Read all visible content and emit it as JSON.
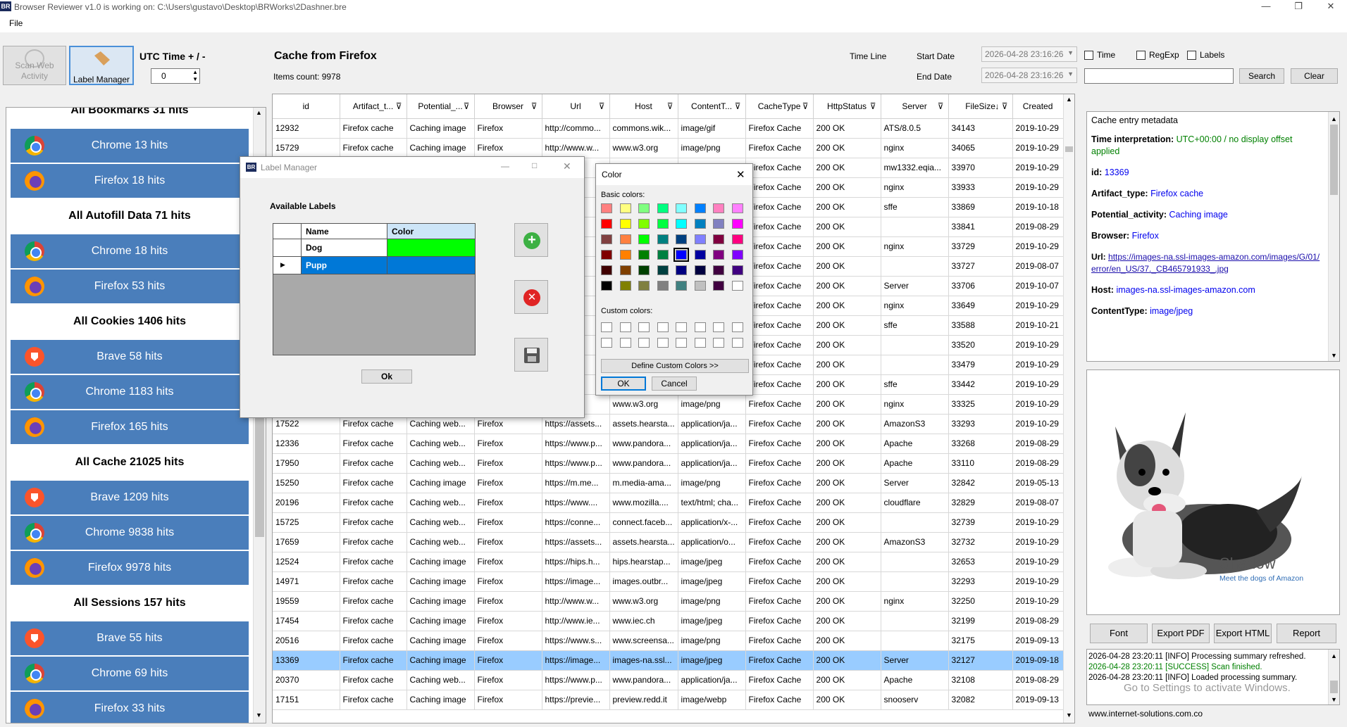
{
  "window": {
    "logo": "BR",
    "title": "Browser Reviewer v1.0 is working on:  C:\\Users\\gustavo\\Desktop\\BRWorks\\2Dashner.bre"
  },
  "menu": {
    "file": "File"
  },
  "toolbar": {
    "scan_label": "Scan Web Activity",
    "label_manager": "Label Manager",
    "utc_label": "UTC Time + / -",
    "utc_value": "0"
  },
  "cache": {
    "title": "Cache from Firefox",
    "count": "Items count: 9978"
  },
  "filters": {
    "timeline": "Time Line",
    "start_label": "Start Date",
    "end_label": "End Date",
    "start_value": "2026-04-28 23:16:26",
    "end_value": "2026-04-28 23:16:26",
    "time": "Time",
    "regexp": "RegExp",
    "labels": "Labels",
    "search": "Search",
    "clear": "Clear"
  },
  "left": {
    "rows": [
      {
        "type": "hdr",
        "text": "All Bookmarks 31 hits"
      },
      {
        "type": "item",
        "icon": "chrome",
        "text": "Chrome 13 hits"
      },
      {
        "type": "item",
        "icon": "firefox",
        "text": "Firefox 18 hits"
      },
      {
        "type": "hdr",
        "text": "All Autofill Data 71 hits"
      },
      {
        "type": "item",
        "icon": "chrome",
        "text": "Chrome 18 hits"
      },
      {
        "type": "item",
        "icon": "firefox",
        "text": "Firefox 53 hits"
      },
      {
        "type": "hdr",
        "text": "All Cookies 1406 hits"
      },
      {
        "type": "item",
        "icon": "brave",
        "text": "Brave 58 hits"
      },
      {
        "type": "item",
        "icon": "chrome",
        "text": "Chrome 1183 hits"
      },
      {
        "type": "item",
        "icon": "firefox",
        "text": "Firefox 165 hits"
      },
      {
        "type": "hdr",
        "text": "All Cache 21025 hits"
      },
      {
        "type": "item",
        "icon": "brave",
        "text": "Brave 1209 hits"
      },
      {
        "type": "item",
        "icon": "chrome",
        "text": "Chrome 9838 hits"
      },
      {
        "type": "item",
        "icon": "firefox",
        "text": "Firefox 9978 hits"
      },
      {
        "type": "hdr",
        "text": "All Sessions 157 hits"
      },
      {
        "type": "item",
        "icon": "brave",
        "text": "Brave 55 hits"
      },
      {
        "type": "item",
        "icon": "chrome",
        "text": "Chrome 69 hits"
      },
      {
        "type": "item",
        "icon": "firefox",
        "text": "Firefox 33 hits"
      }
    ]
  },
  "grid": {
    "columns": [
      "id",
      "Artifact_t...",
      "Potential_...",
      "Browser",
      "Url",
      "Host",
      "ContentT...",
      "CacheType",
      "HttpStatus",
      "Server",
      "FileSize",
      "Created"
    ],
    "rows": [
      [
        "12932",
        "Firefox cache",
        "Caching image",
        "Firefox",
        "http://commo...",
        "commons.wik...",
        "image/gif",
        "Firefox Cache",
        "200 OK",
        "ATS/8.0.5",
        "34143",
        "2019-10-29"
      ],
      [
        "15729",
        "Firefox cache",
        "Caching image",
        "Firefox",
        "http://www.w...",
        "www.w3.org",
        "image/png",
        "Firefox Cache",
        "200 OK",
        "nginx",
        "34065",
        "2019-10-29"
      ],
      [
        "",
        "",
        "",
        "",
        "",
        "",
        "",
        "Firefox Cache",
        "200 OK",
        "mw1332.eqia...",
        "33970",
        "2019-10-29"
      ],
      [
        "",
        "",
        "",
        "",
        "",
        "",
        "",
        "Firefox Cache",
        "200 OK",
        "nginx",
        "33933",
        "2019-10-29"
      ],
      [
        "",
        "",
        "",
        "",
        "",
        "",
        "",
        "Firefox Cache",
        "200 OK",
        "sffe",
        "33869",
        "2019-10-18"
      ],
      [
        "",
        "",
        "",
        "",
        "",
        "",
        "",
        "Firefox Cache",
        "200 OK",
        "",
        "33841",
        "2019-08-29"
      ],
      [
        "",
        "",
        "",
        "",
        "",
        "",
        "",
        "Firefox Cache",
        "200 OK",
        "nginx",
        "33729",
        "2019-10-29"
      ],
      [
        "",
        "",
        "",
        "",
        "",
        "",
        "",
        "Firefox Cache",
        "200 OK",
        "",
        "33727",
        "2019-08-07"
      ],
      [
        "",
        "",
        "",
        "",
        "",
        "",
        "",
        "Firefox Cache",
        "200 OK",
        "Server",
        "33706",
        "2019-10-07"
      ],
      [
        "",
        "",
        "",
        "",
        "",
        "",
        "",
        "Firefox Cache",
        "200 OK",
        "nginx",
        "33649",
        "2019-10-29"
      ],
      [
        "",
        "",
        "",
        "",
        "",
        "",
        "",
        "Firefox Cache",
        "200 OK",
        "sffe",
        "33588",
        "2019-10-21"
      ],
      [
        "",
        "",
        "",
        "",
        "",
        "",
        "",
        "Firefox Cache",
        "200 OK",
        "",
        "33520",
        "2019-10-29"
      ],
      [
        "",
        "",
        "",
        "",
        "",
        "",
        "",
        "Firefox Cache",
        "200 OK",
        "",
        "33479",
        "2019-10-29"
      ],
      [
        "",
        "",
        "",
        "",
        "",
        "",
        "",
        "Firefox Cache",
        "200 OK",
        "sffe",
        "33442",
        "2019-10-29"
      ],
      [
        "",
        "",
        "",
        "",
        "",
        "www.w3.org",
        "image/png",
        "Firefox Cache",
        "200 OK",
        "nginx",
        "33325",
        "2019-10-29"
      ],
      [
        "17522",
        "Firefox cache",
        "Caching web...",
        "Firefox",
        "https://assets...",
        "assets.hearsta...",
        "application/ja...",
        "Firefox Cache",
        "200 OK",
        "AmazonS3",
        "33293",
        "2019-10-29"
      ],
      [
        "12336",
        "Firefox cache",
        "Caching web...",
        "Firefox",
        "https://www.p...",
        "www.pandora...",
        "application/ja...",
        "Firefox Cache",
        "200 OK",
        "Apache",
        "33268",
        "2019-08-29"
      ],
      [
        "17950",
        "Firefox cache",
        "Caching web...",
        "Firefox",
        "https://www.p...",
        "www.pandora...",
        "application/ja...",
        "Firefox Cache",
        "200 OK",
        "Apache",
        "33110",
        "2019-08-29"
      ],
      [
        "15250",
        "Firefox cache",
        "Caching image",
        "Firefox",
        "https://m.me...",
        "m.media-ama...",
        "image/png",
        "Firefox Cache",
        "200 OK",
        "Server",
        "32842",
        "2019-05-13"
      ],
      [
        "20196",
        "Firefox cache",
        "Caching web...",
        "Firefox",
        "https://www....",
        "www.mozilla....",
        "text/html; cha...",
        "Firefox Cache",
        "200 OK",
        "cloudflare",
        "32829",
        "2019-08-07"
      ],
      [
        "15725",
        "Firefox cache",
        "Caching web...",
        "Firefox",
        "https://conne...",
        "connect.faceb...",
        "application/x-...",
        "Firefox Cache",
        "200 OK",
        "",
        "32739",
        "2019-10-29"
      ],
      [
        "17659",
        "Firefox cache",
        "Caching web...",
        "Firefox",
        "https://assets...",
        "assets.hearsta...",
        "application/o...",
        "Firefox Cache",
        "200 OK",
        "AmazonS3",
        "32732",
        "2019-10-29"
      ],
      [
        "12524",
        "Firefox cache",
        "Caching image",
        "Firefox",
        "https://hips.h...",
        "hips.hearstap...",
        "image/jpeg",
        "Firefox Cache",
        "200 OK",
        "",
        "32653",
        "2019-10-29"
      ],
      [
        "14971",
        "Firefox cache",
        "Caching image",
        "Firefox",
        "https://image...",
        "images.outbr...",
        "image/jpeg",
        "Firefox Cache",
        "200 OK",
        "",
        "32293",
        "2019-10-29"
      ],
      [
        "19559",
        "Firefox cache",
        "Caching image",
        "Firefox",
        "http://www.w...",
        "www.w3.org",
        "image/png",
        "Firefox Cache",
        "200 OK",
        "nginx",
        "32250",
        "2019-10-29"
      ],
      [
        "17454",
        "Firefox cache",
        "Caching image",
        "Firefox",
        "http://www.ie...",
        "www.iec.ch",
        "image/jpeg",
        "Firefox Cache",
        "200 OK",
        "",
        "32199",
        "2019-08-29"
      ],
      [
        "20516",
        "Firefox cache",
        "Caching image",
        "Firefox",
        "https://www.s...",
        "www.screensa...",
        "image/png",
        "Firefox Cache",
        "200 OK",
        "",
        "32175",
        "2019-09-13"
      ],
      [
        "13369",
        "Firefox cache",
        "Caching image",
        "Firefox",
        "https://image...",
        "images-na.ssl...",
        "image/jpeg",
        "Firefox Cache",
        "200 OK",
        "Server",
        "32127",
        "2019-09-18"
      ],
      [
        "20370",
        "Firefox cache",
        "Caching web...",
        "Firefox",
        "https://www.p...",
        "www.pandora...",
        "application/ja...",
        "Firefox Cache",
        "200 OK",
        "Apache",
        "32108",
        "2019-08-29"
      ],
      [
        "17151",
        "Firefox cache",
        "Caching image",
        "Firefox",
        "https://previe...",
        "preview.redd.it",
        "image/webp",
        "Firefox Cache",
        "200 OK",
        "snooserv",
        "32082",
        "2019-09-13"
      ]
    ],
    "selected_row": 27
  },
  "metadata": {
    "header": "Cache entry metadata",
    "time_label": "Time interpretation:",
    "time_value": "UTC+00:00 / no display offset applied",
    "id_label": "id:",
    "id_value": "13369",
    "artifact_label": "Artifact_type:",
    "artifact_value": "Firefox cache",
    "potential_label": "Potential_activity:",
    "potential_value": "Caching image",
    "browser_label": "Browser:",
    "browser_value": "Firefox",
    "url_label": "Url:",
    "url_value": "https://images-na.ssl-images-amazon.com/images/G/01/error/en_US/37._CB465791933_.jpg",
    "host_label": "Host:",
    "host_value": "images-na.ssl-images-amazon.com",
    "content_label": "ContentType:",
    "content_value": "image/jpeg"
  },
  "preview": {
    "name": "Shadow",
    "caption": "Meet the dogs of Amazon"
  },
  "actions": {
    "font": "Font",
    "pdf": "Export PDF",
    "html": "Export HTML",
    "report": "Report"
  },
  "log": {
    "l1": "2026-04-28 23:20:11 [INFO] Processing summary refreshed.",
    "l2": "2026-04-28 23:20:11 [SUCCESS] Scan finished.",
    "l3": "2026-04-28 23:20:11 [INFO] Loaded processing summary.",
    "watermark": "Go to Settings to activate Windows."
  },
  "footer": "www.internet-solutions.com.co",
  "label_manager": {
    "title": "Label Manager",
    "available": "Available Labels",
    "col_name": "Name",
    "col_color": "Color",
    "rows": [
      {
        "name": "Dog",
        "color": "#00ff00"
      },
      {
        "name": "Pupp",
        "color": "#0078d7"
      }
    ],
    "ok": "Ok"
  },
  "color_dialog": {
    "title": "Color",
    "basic": "Basic colors:",
    "custom": "Custom colors:",
    "define": "Define Custom Colors >>",
    "ok": "OK",
    "cancel": "Cancel",
    "swatches": [
      "#ff8080",
      "#ffff80",
      "#80ff80",
      "#00ff80",
      "#80ffff",
      "#0080ff",
      "#ff80c0",
      "#ff80ff",
      "#ff0000",
      "#ffff00",
      "#80ff00",
      "#00ff40",
      "#00ffff",
      "#0080c0",
      "#8080c0",
      "#ff00ff",
      "#804040",
      "#ff8040",
      "#00ff00",
      "#008080",
      "#004080",
      "#8080ff",
      "#800040",
      "#ff0080",
      "#800000",
      "#ff8000",
      "#008000",
      "#008040",
      "#0000ff",
      "#0000a0",
      "#800080",
      "#8000ff",
      "#400000",
      "#804000",
      "#004000",
      "#004040",
      "#000080",
      "#000040",
      "#400040",
      "#400080",
      "#000000",
      "#808000",
      "#808040",
      "#808080",
      "#408080",
      "#c0c0c0",
      "#400040",
      "#ffffff"
    ],
    "selected_swatch": 28
  }
}
